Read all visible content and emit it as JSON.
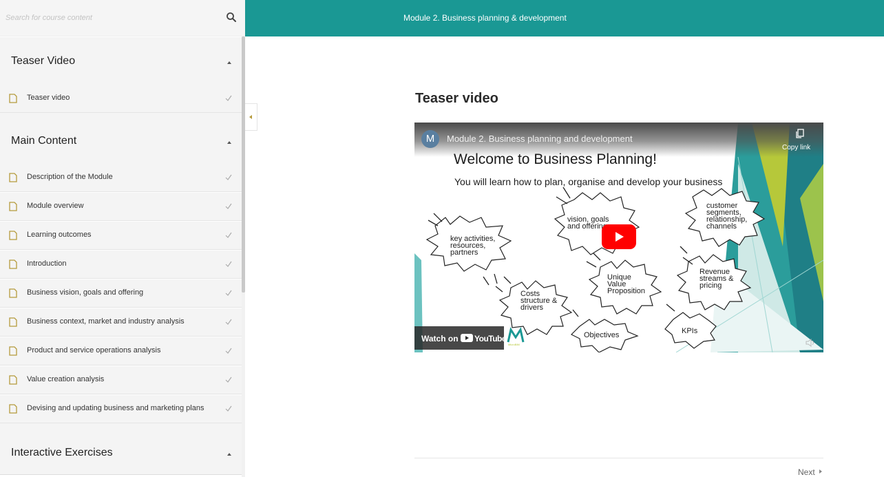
{
  "search": {
    "placeholder": "Search for course content"
  },
  "topbar": {
    "module_title": "Module 2. Business planning & development"
  },
  "sidebar": {
    "sections": [
      {
        "title": "Teaser Video",
        "items": [
          "Teaser video"
        ]
      },
      {
        "title": "Main Content",
        "items": [
          "Description of the Module",
          "Module overview",
          "Learning outcomes",
          "Introduction",
          "Business vision, goals and offering",
          "Business context, market and industry analysis",
          "Product and service operations analysis",
          "Value creation analysis",
          "Devising and updating business and marketing plans"
        ]
      },
      {
        "title": "Interactive Exercises",
        "items": []
      }
    ]
  },
  "main": {
    "page_title": "Teaser video",
    "video": {
      "channel_initial": "M",
      "title": "Module 2. Business planning and development",
      "copy_label": "Copy link",
      "slide_title": "Welcome to Business Planning!",
      "slide_subtitle": "You will learn how to  plan, organise and develop your business",
      "bubbles": {
        "key_activities": "key activities,\nresources,\npartners",
        "vision": "vision, goals\nand offering",
        "customer": "customer\nsegments,\nrelationship,\nchannels",
        "uvp": "Unique\nValue\nProposition",
        "revenue": "Revenue\nstreams &\npricing",
        "costs": "Costs\nstructure &\ndrivers",
        "objectives": "Objectives",
        "kpis": "KPIs"
      },
      "watch_on": "Watch on",
      "youtube_word": "YouTube",
      "brand_text": "MicroBIM"
    },
    "next_label": "Next"
  },
  "colors": {
    "accent": "#1a9894",
    "doc_icon": "#b59a3b",
    "play": "#ff0000"
  }
}
